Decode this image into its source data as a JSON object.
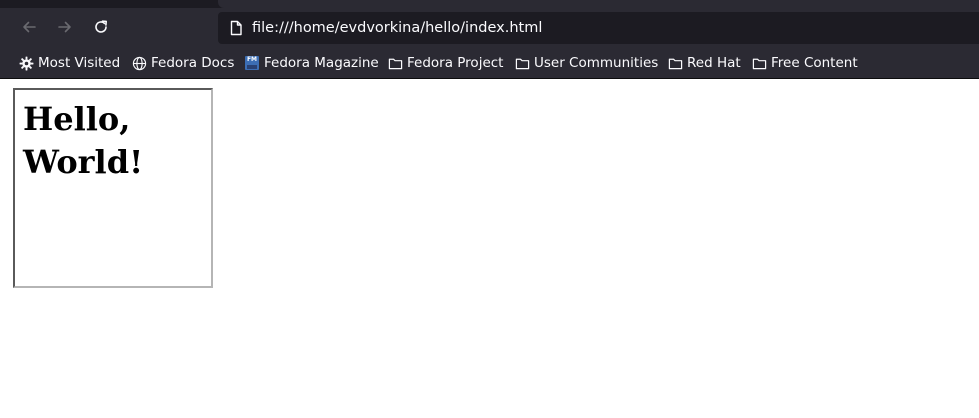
{
  "toolbar": {
    "back_icon": "arrow-left-icon",
    "forward_icon": "arrow-right-icon",
    "reload_icon": "reload-icon",
    "url": "file:///home/evdvorkina/hello/index.html",
    "page_icon": "page-icon"
  },
  "bookmarks": [
    {
      "label": "Most Visited",
      "icon": "gear-icon"
    },
    {
      "label": "Fedora Docs",
      "icon": "globe-icon"
    },
    {
      "label": "Fedora Magazine",
      "icon": "fedora-magazine-icon"
    },
    {
      "label": "Fedora Project",
      "icon": "folder-icon"
    },
    {
      "label": "User Communities",
      "icon": "folder-icon"
    },
    {
      "label": "Red Hat",
      "icon": "folder-icon"
    },
    {
      "label": "Free Content",
      "icon": "folder-icon"
    }
  ],
  "page": {
    "heading_line1": "Hello,",
    "heading_line2": "World!"
  },
  "colors": {
    "toolbar_bg": "#2b2a33",
    "urlbar_bg": "#1c1b22",
    "toolbar_text": "#fbfbfe",
    "fedora_blue": "#3c6eb4"
  }
}
